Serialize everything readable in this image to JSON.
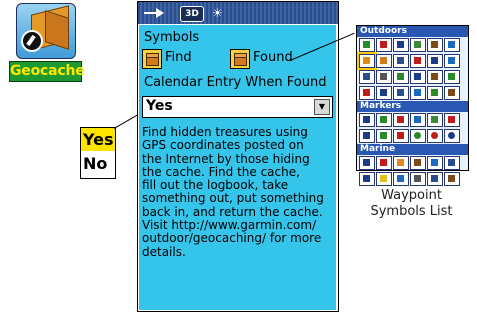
{
  "app": {
    "name": "Geocache"
  },
  "callout": {
    "yes": "Yes",
    "no": "No"
  },
  "symbols": {
    "label": "Symbols",
    "find": "Find",
    "found": "Found"
  },
  "calendar": {
    "label": "Calendar Entry When Found",
    "value": "Yes"
  },
  "description": "Find hidden treasures using\nGPS coordinates posted on\nthe Internet by those hiding\nthe cache. Find the cache,\nfill out the logbook, take\nsomething out, put something\nback in, and return the cache.\nVisit http://www.garmin.com/\noutdoor/geocaching/ for more\ndetails.",
  "toolbar": {
    "mode3d": "3D"
  },
  "waypoint_list": {
    "headers": [
      "Outdoors",
      "Markers",
      "Marine"
    ],
    "caption_line1": "Waypoint",
    "caption_line2": "Symbols List"
  },
  "colors": {
    "screen_bg": "#35c4ea",
    "title_bar": "#2a4d8c",
    "accent_yellow": "#ffe400",
    "app_label_green": "#1c9a2f"
  }
}
